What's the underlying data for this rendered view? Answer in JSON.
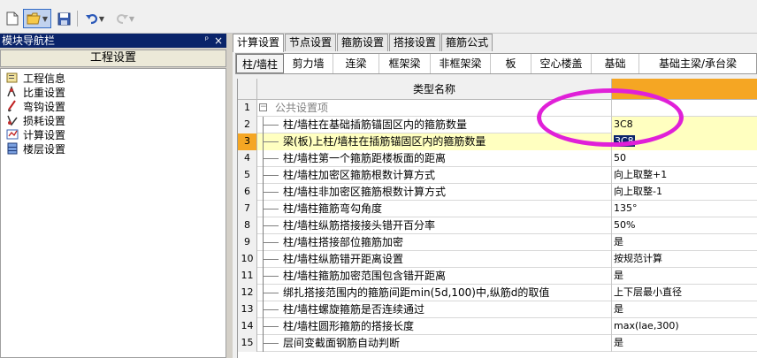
{
  "toolbar": {
    "buttons": [
      "new-file",
      "open-file",
      "save-file",
      "undo",
      "redo"
    ],
    "accent": "#316ac5"
  },
  "nav": {
    "title": "模块导航栏",
    "pin": "ᵖ",
    "close": "×",
    "subtitle": "工程设置",
    "items": [
      {
        "label": "工程信息",
        "icon": "info-icon"
      },
      {
        "label": "比重设置",
        "icon": "weight-icon"
      },
      {
        "label": "弯钩设置",
        "icon": "hook-icon"
      },
      {
        "label": "损耗设置",
        "icon": "loss-icon"
      },
      {
        "label": "计算设置",
        "icon": "calc-icon"
      },
      {
        "label": "楼层设置",
        "icon": "floor-icon"
      }
    ]
  },
  "tabs_top": [
    "计算设置",
    "节点设置",
    "箍筋设置",
    "搭接设置",
    "箍筋公式"
  ],
  "tabs_sub": [
    "柱/墙柱",
    "剪力墙",
    "连梁",
    "框架梁",
    "非框架梁",
    "板",
    "空心楼盖",
    "基础",
    "基础主梁/承台梁"
  ],
  "grid": {
    "header": "类型名称",
    "group_label": "公共设置项",
    "rows": [
      {
        "num": "2",
        "name": "柱/墙柱在基础插筋锚固区内的箍筋数量",
        "value": "3C8"
      },
      {
        "num": "3",
        "name": "梁(板)上柱/墙柱在插筋锚固区内的箍筋数量",
        "value": "3C8"
      },
      {
        "num": "4",
        "name": "柱/墙柱第一个箍筋距楼板面的距离",
        "value": "50"
      },
      {
        "num": "5",
        "name": "柱/墙柱加密区箍筋根数计算方式",
        "value": "向上取整+1"
      },
      {
        "num": "6",
        "name": "柱/墙柱非加密区箍筋根数计算方式",
        "value": "向上取整-1"
      },
      {
        "num": "7",
        "name": "柱/墙柱箍筋弯勾角度",
        "value": "135°"
      },
      {
        "num": "8",
        "name": "柱/墙柱纵筋搭接接头错开百分率",
        "value": "50%"
      },
      {
        "num": "9",
        "name": "柱/墙柱搭接部位箍筋加密",
        "value": "是"
      },
      {
        "num": "10",
        "name": "柱/墙柱纵筋错开距离设置",
        "value": "按规范计算"
      },
      {
        "num": "11",
        "name": "柱/墙柱箍筋加密范围包含错开距离",
        "value": "是"
      },
      {
        "num": "12",
        "name": "绑扎搭接范围内的箍筋间距min(5d,100)中,纵筋d的取值",
        "value": "上下层最小直径"
      },
      {
        "num": "13",
        "name": "柱/墙柱螺旋箍筋是否连续通过",
        "value": "是"
      },
      {
        "num": "14",
        "name": "柱/墙柱圆形箍筋的搭接长度",
        "value": "max(lae,300)"
      },
      {
        "num": "15",
        "name": "层间变截面钢筋自动判断",
        "value": "是"
      }
    ],
    "first_num": "1",
    "header_color": "#f5a623",
    "highlight_color": "#ffffc0"
  },
  "annotation_color": "#e020d8"
}
